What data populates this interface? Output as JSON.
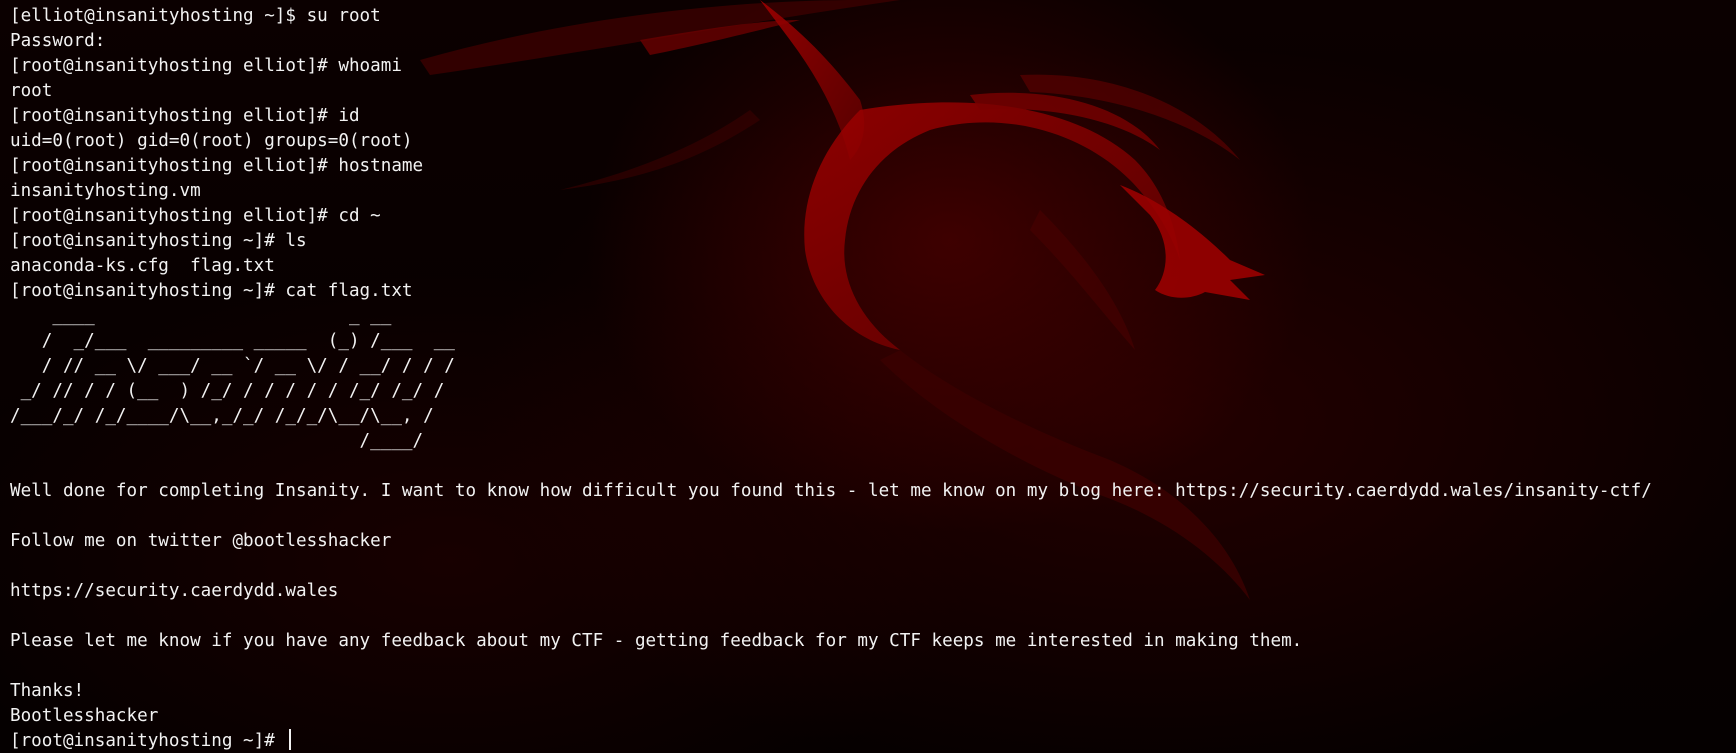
{
  "theme": {
    "background": "#0a0000",
    "accent_red": "#8a0000",
    "text_color": "#f2f2f2"
  },
  "wallpaper": {
    "icon": "kali-dragon-icon"
  },
  "terminal": {
    "lines": [
      "[elliot@insanityhosting ~]$ su root",
      "Password:",
      "[root@insanityhosting elliot]# whoami",
      "root",
      "[root@insanityhosting elliot]# id",
      "uid=0(root) gid=0(root) groups=0(root)",
      "[root@insanityhosting elliot]# hostname",
      "insanityhosting.vm",
      "[root@insanityhosting elliot]# cd ~",
      "[root@insanityhosting ~]# ls",
      "anaconda-ks.cfg  flag.txt",
      "[root@insanityhosting ~]# cat flag.txt",
      "    ____                        _ __",
      "   /  _/___  _________ _____  (_) /___  __",
      "   / // __ \\/ ___/ __ `/ __ \\/ / __/ / / /",
      " _/ // / / (__  ) /_/ / / / / / /_/ /_/ /",
      "/___/_/ /_/____/\\__,_/_/ /_/_/\\__/\\__, /",
      "                                 /____/",
      "",
      "Well done for completing Insanity. I want to know how difficult you found this - let me know on my blog here: https://security.caerdydd.wales/insanity-ctf/",
      "",
      "Follow me on twitter @bootlesshacker",
      "",
      "https://security.caerdydd.wales",
      "",
      "Please let me know if you have any feedback about my CTF - getting feedback for my CTF keeps me interested in making them.",
      "",
      "Thanks!",
      "Bootlesshacker"
    ],
    "current_prompt": "[root@insanityhosting ~]# "
  }
}
